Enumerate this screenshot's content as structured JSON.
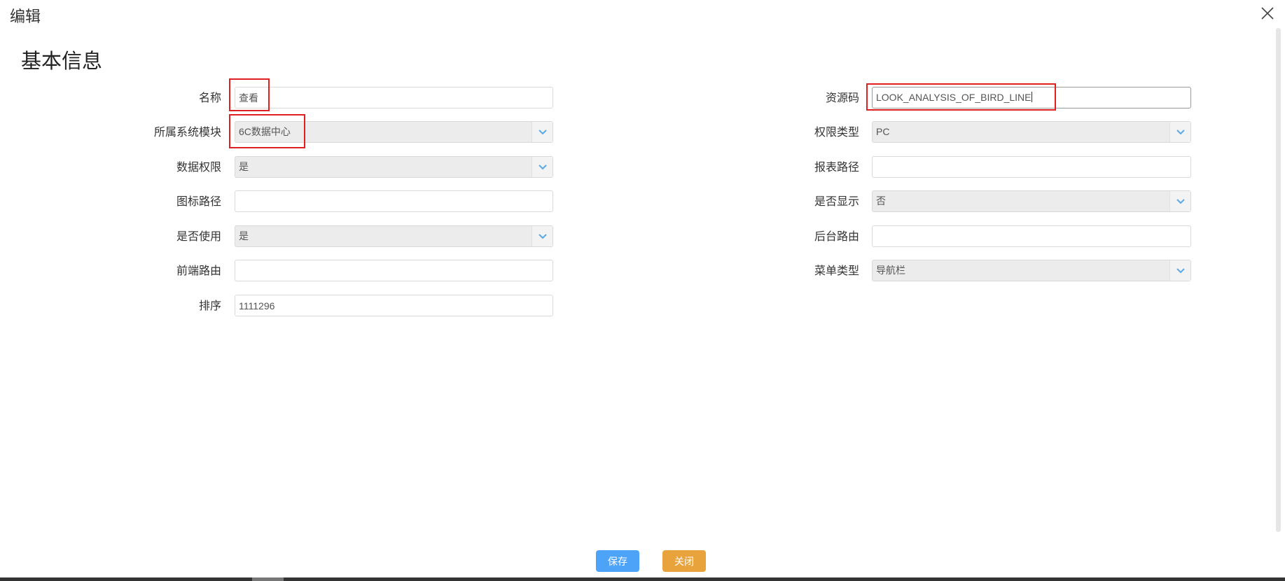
{
  "window": {
    "title": "编辑",
    "close_icon": "close-icon"
  },
  "section_title": "基本信息",
  "left_fields": [
    {
      "label": "名称",
      "type": "input",
      "value": "查看",
      "highlighted": true
    },
    {
      "label": "所属系统模块",
      "type": "select",
      "value": "6C数据中心",
      "highlighted": true
    },
    {
      "label": "数据权限",
      "type": "select",
      "value": "是"
    },
    {
      "label": "图标路径",
      "type": "input",
      "value": ""
    },
    {
      "label": "是否使用",
      "type": "select",
      "value": "是"
    },
    {
      "label": "前端路由",
      "type": "input",
      "value": ""
    },
    {
      "label": "排序",
      "type": "input",
      "value": "1111296"
    }
  ],
  "right_fields": [
    {
      "label": "资源码",
      "type": "input",
      "value": "LOOK_ANALYSIS_OF_BIRD_LINE",
      "highlighted": true,
      "focused": true
    },
    {
      "label": "权限类型",
      "type": "select",
      "value": "PC"
    },
    {
      "label": "报表路径",
      "type": "input",
      "value": ""
    },
    {
      "label": "是否显示",
      "type": "select",
      "value": "否"
    },
    {
      "label": "后台路由",
      "type": "input",
      "value": ""
    },
    {
      "label": "菜单类型",
      "type": "select",
      "value": "导航栏"
    }
  ],
  "buttons": {
    "save_label": "保存",
    "close_label": "关闭"
  },
  "colors": {
    "save_button": "#4da3f7",
    "close_button": "#e8a33d",
    "highlight_border": "#e02020",
    "select_arrow": "#5aa9e6",
    "select_background": "#ececec"
  }
}
